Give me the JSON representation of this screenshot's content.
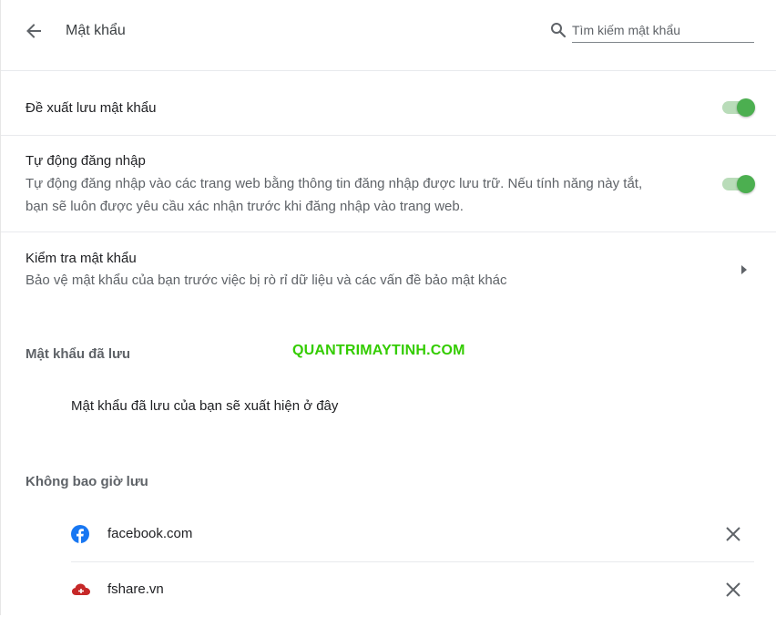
{
  "header": {
    "title": "Mật khẩu",
    "search_placeholder": "Tìm kiếm mật khẩu"
  },
  "settings": {
    "offer_save": {
      "label": "Đề xuất lưu mật khẩu",
      "enabled": true
    },
    "auto_signin": {
      "label": "Tự động đăng nhập",
      "description_line1": "Tự động đăng nhập vào các trang web bằng thông tin đăng nhập được lưu trữ. Nếu tính năng này tắt,",
      "description_line2": "bạn sẽ luôn được yêu cầu xác nhận trước khi đăng nhập vào trang web.",
      "enabled": true
    },
    "password_check": {
      "label": "Kiểm tra mật khẩu",
      "description": "Bảo vệ mật khẩu của bạn trước việc bị rò rỉ dữ liệu và các vấn đề bảo mật khác"
    }
  },
  "saved_passwords": {
    "title": "Mật khẩu đã lưu",
    "empty_message": "Mật khẩu đã lưu của bạn sẽ xuất hiện ở đây"
  },
  "watermark": "QUANTRIMAYTINH.COM",
  "never_saved": {
    "title": "Không bao giờ lưu",
    "sites": [
      {
        "domain": "facebook.com",
        "icon": "facebook-icon"
      },
      {
        "domain": "fshare.vn",
        "icon": "fshare-cloud-icon"
      }
    ]
  },
  "colors": {
    "toggle_on": "#4caf50",
    "toggle_track": "#b9dcb9",
    "watermark": "#33cc00",
    "facebook": "#1877f2",
    "fshare": "#c62828"
  }
}
